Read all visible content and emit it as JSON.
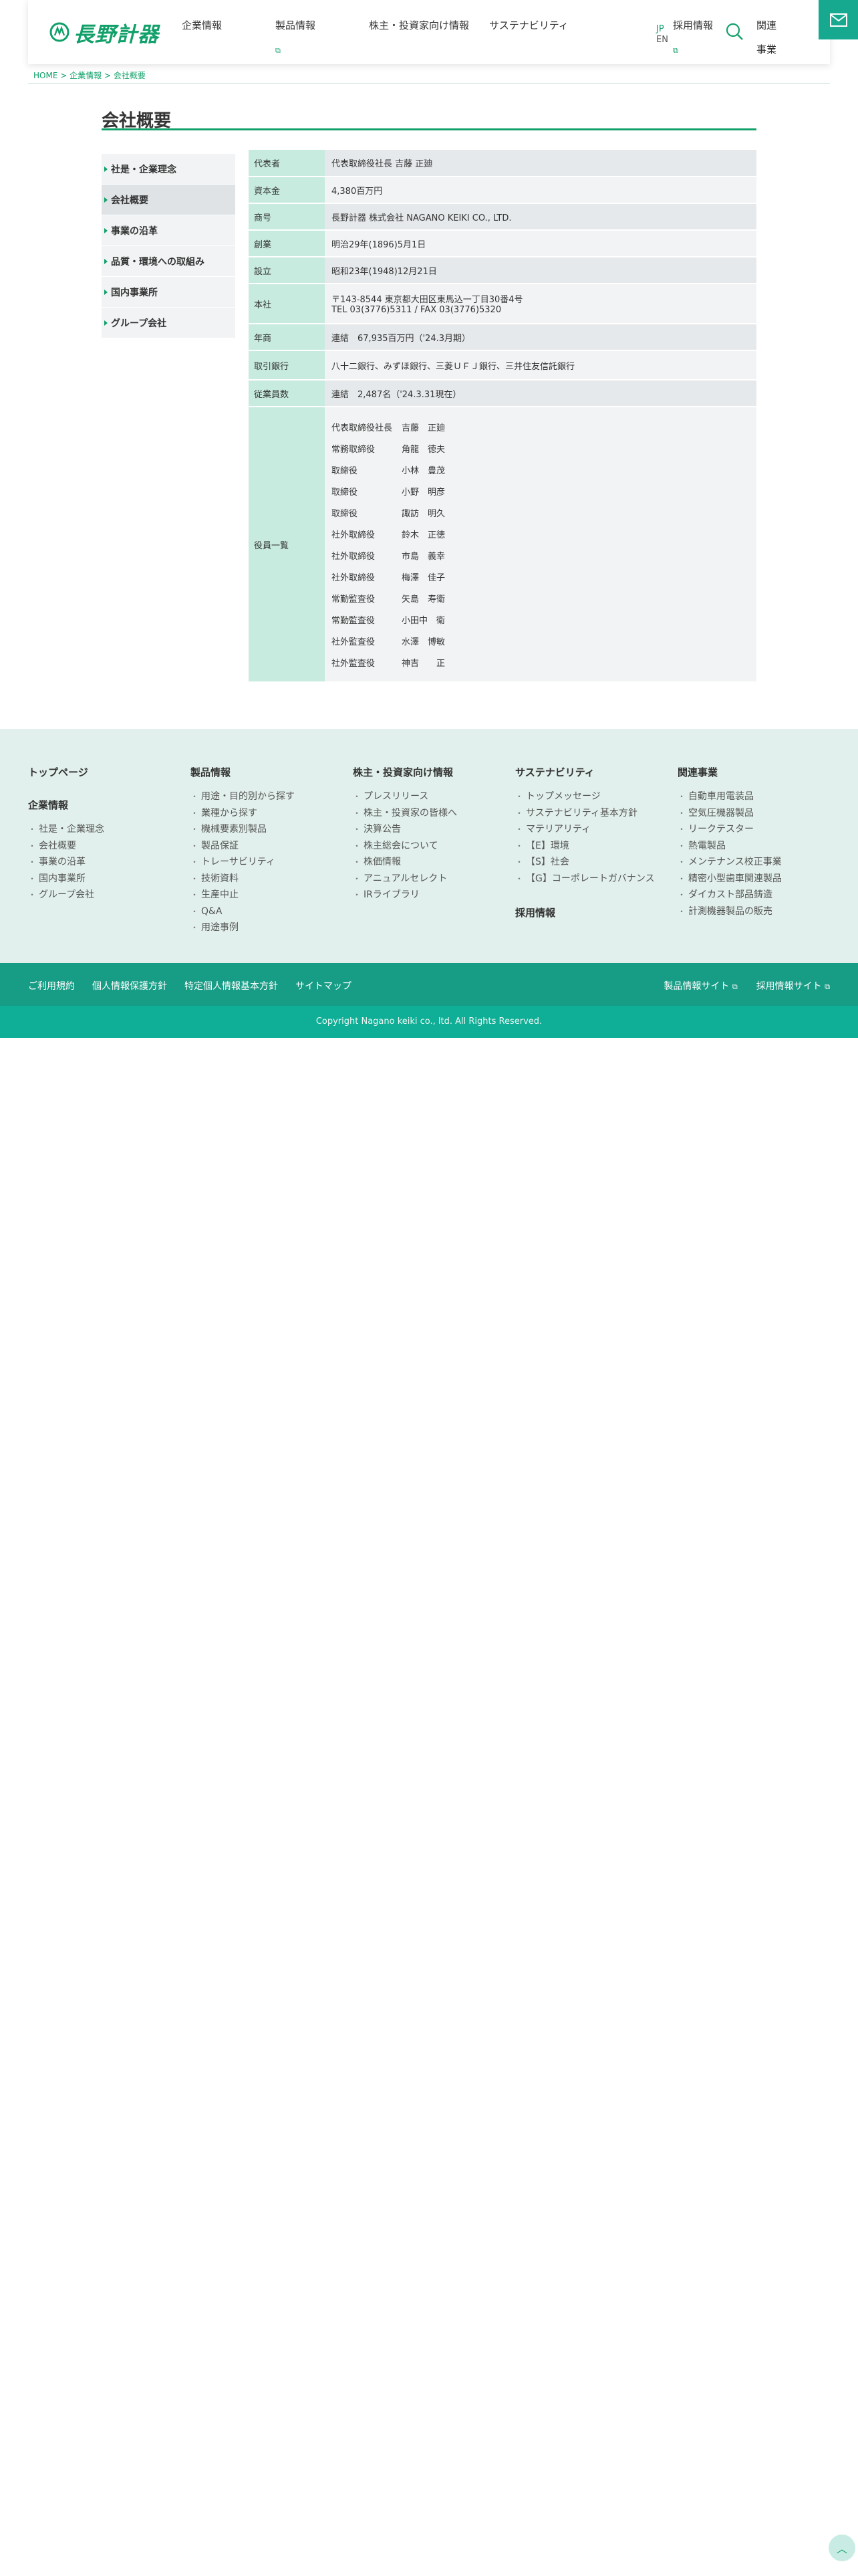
{
  "header": {
    "logo_text": "長野計器",
    "nav": [
      {
        "label": "企業情報",
        "ext": false
      },
      {
        "label": "製品情報",
        "ext": true
      },
      {
        "label": "株主・投資家向け情報",
        "ext": false
      },
      {
        "label": "サステナビリティ",
        "ext": false
      },
      {
        "label": "採用情報",
        "ext": true
      }
    ],
    "lang_jp": "JP",
    "lang_en": "EN",
    "related_label": "関連事業"
  },
  "breadcrumb": {
    "home": "HOME",
    "sep": ">",
    "level1": "企業情報",
    "current": "会社概要"
  },
  "page_title": "会社概要",
  "side_menu": [
    {
      "label": "社是・企業理念",
      "active": false
    },
    {
      "label": "会社概要",
      "active": true
    },
    {
      "label": "事業の沿革",
      "active": false
    },
    {
      "label": "品質・環境への取組み",
      "active": false
    },
    {
      "label": "国内事業所",
      "active": false
    },
    {
      "label": "グループ会社",
      "active": false
    }
  ],
  "table": {
    "rows": [
      {
        "label": "代表者",
        "value": "代表取締役社長 吉藤 正廸"
      },
      {
        "label": "資本金",
        "value": "4,380百万円"
      },
      {
        "label": "商号",
        "value": "長野計器 株式会社 NAGANO KEIKI CO., LTD."
      },
      {
        "label": "創業",
        "value": "明治29年(1896)5月1日"
      },
      {
        "label": "設立",
        "value": "昭和23年(1948)12月21日"
      },
      {
        "label": "本社",
        "value": "〒143-8544 東京都大田区東馬込一丁目30番4号",
        "value2": "TEL 03(3776)5311 / FAX 03(3776)5320"
      },
      {
        "label": "年商",
        "value": "連結　67,935百万円（'24.3月期）"
      },
      {
        "label": "取引銀行",
        "value": "八十二銀行、みずほ銀行、三菱ＵＦＪ銀行、三井住友信託銀行"
      },
      {
        "label": "従業員数",
        "value": "連結　2,487名（'24.3.31現在）"
      }
    ],
    "officers_label": "役員一覧",
    "officers": [
      {
        "role": "代表取締役社長",
        "name": "吉藤　正廸"
      },
      {
        "role": "常務取締役",
        "name": "角龍　徳夫"
      },
      {
        "role": "取締役",
        "name": "小林　豊茂"
      },
      {
        "role": "取締役",
        "name": "小野　明彦"
      },
      {
        "role": "取締役",
        "name": "諏訪　明久"
      },
      {
        "role": "社外取締役",
        "name": "鈴木　正徳"
      },
      {
        "role": "社外取締役",
        "name": "市島　義幸"
      },
      {
        "role": "社外取締役",
        "name": "梅澤　佳子"
      },
      {
        "role": "常勤監査役",
        "name": "矢島　寿衛"
      },
      {
        "role": "常勤監査役",
        "name": "小田中　衛"
      },
      {
        "role": "社外監査役",
        "name": "水澤　博敏"
      },
      {
        "role": "社外監査役",
        "name": "神吉　　正"
      }
    ]
  },
  "footer": {
    "col1": {
      "head": "トップページ",
      "head2": "企業情報",
      "links": [
        "社是・企業理念",
        "会社概要",
        "事業の沿革",
        "国内事業所",
        "グループ会社"
      ]
    },
    "col2": {
      "head": "製品情報",
      "links": [
        "用途・目的別から探す",
        "業種から探す",
        "機械要素別製品",
        "製品保証",
        "トレーサビリティ",
        "技術資料",
        "生産中止",
        "Q&A",
        "用途事例"
      ]
    },
    "col3": {
      "head": "株主・投資家向け情報",
      "links": [
        "プレスリリース",
        "株主・投資家の皆様へ",
        "決算公告",
        "株主総会について",
        "株価情報",
        "アニュアルセレクト",
        "IRライブラリ"
      ]
    },
    "col4": {
      "head": "サステナビリティ",
      "head2": "採用情報",
      "links": [
        "トップメッセージ",
        "サステナビリティ基本方針",
        "マテリアリティ",
        "【E】環境",
        "【S】社会",
        "【G】コーポレートガバナンス"
      ]
    },
    "col5": {
      "head": "関連事業",
      "links": [
        "自動車用電装品",
        "空気圧機器製品",
        "リークテスター",
        "熱電製品",
        "メンテナンス校正事業",
        "精密小型歯車関連製品",
        "ダイカスト部品鋳造",
        "計測機器製品の販売"
      ]
    },
    "bar_links": [
      "ご利用規約",
      "個人情報保護方針",
      "特定個人情報基本方針",
      "サイトマップ"
    ],
    "bar_right": [
      "製品情報サイト",
      "採用情報サイト"
    ],
    "copyright": "Copyright Nagano keiki co., ltd. All Rights Reserved."
  }
}
